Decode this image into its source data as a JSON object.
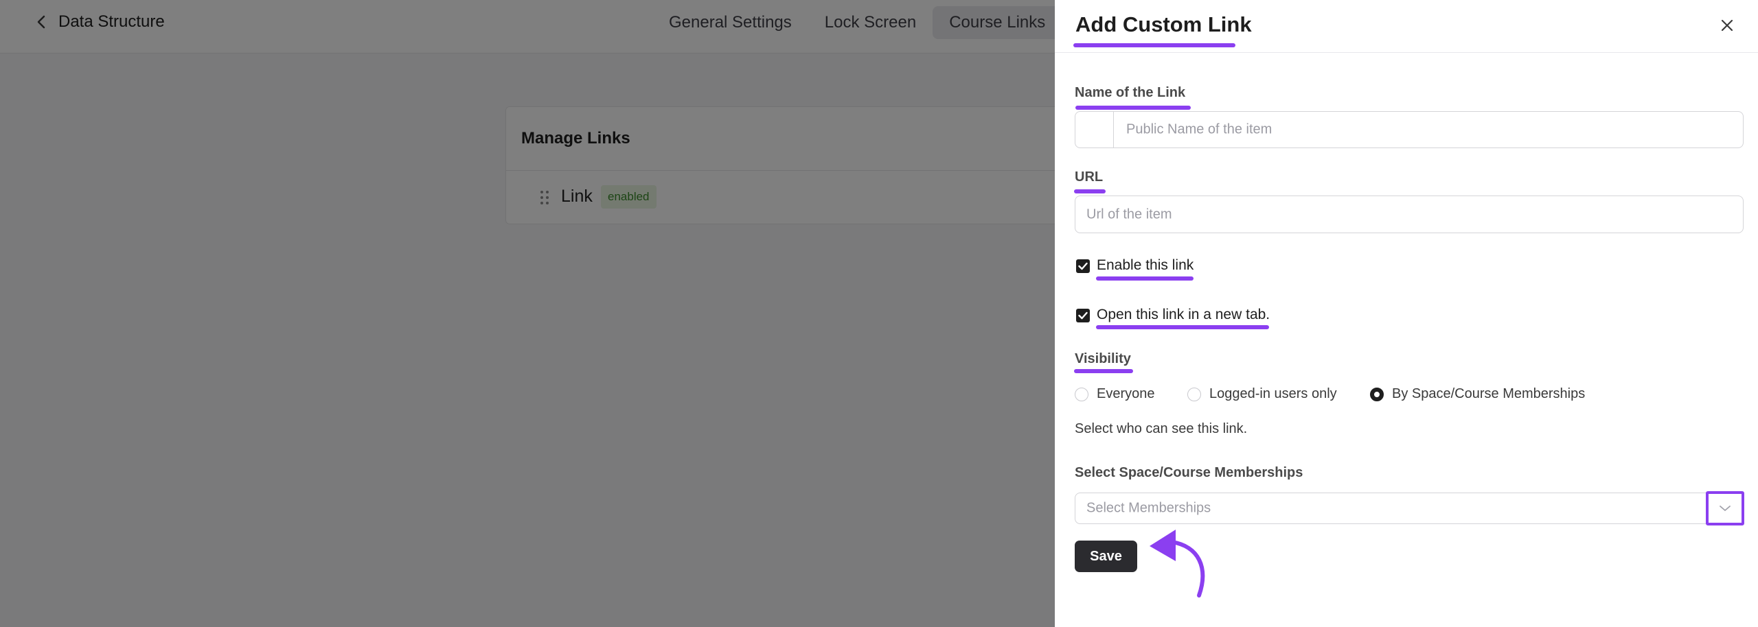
{
  "header": {
    "breadcrumb": "Data Structure",
    "tabs": [
      {
        "label": "General Settings"
      },
      {
        "label": "Lock Screen"
      },
      {
        "label": "Course Links"
      }
    ]
  },
  "manage_links": {
    "title": "Manage Links",
    "rows": [
      {
        "label": "Link",
        "status": "enabled"
      }
    ]
  },
  "drawer": {
    "title": "Add Custom Link",
    "name_label": "Name of the Link",
    "name_placeholder": "Public Name of the item",
    "url_label": "URL",
    "url_placeholder": "Url of the item",
    "enable_label": "Enable this link",
    "enable_checked": true,
    "newtab_label": "Open this link in a new tab.",
    "newtab_checked": true,
    "visibility_label": "Visibility",
    "visibility_options": [
      {
        "label": "Everyone",
        "selected": false
      },
      {
        "label": "Logged-in users only",
        "selected": false
      },
      {
        "label": "By Space/Course Memberships",
        "selected": true
      }
    ],
    "visibility_help": "Select who can see this link.",
    "memberships_label": "Select Space/Course Memberships",
    "memberships_placeholder": "Select Memberships",
    "save_label": "Save"
  },
  "colors": {
    "highlight": "#8b3ff0",
    "primary_button": "#2b2b2f",
    "badge_text": "#3a8a2a",
    "badge_bg": "#e8f5e1"
  }
}
